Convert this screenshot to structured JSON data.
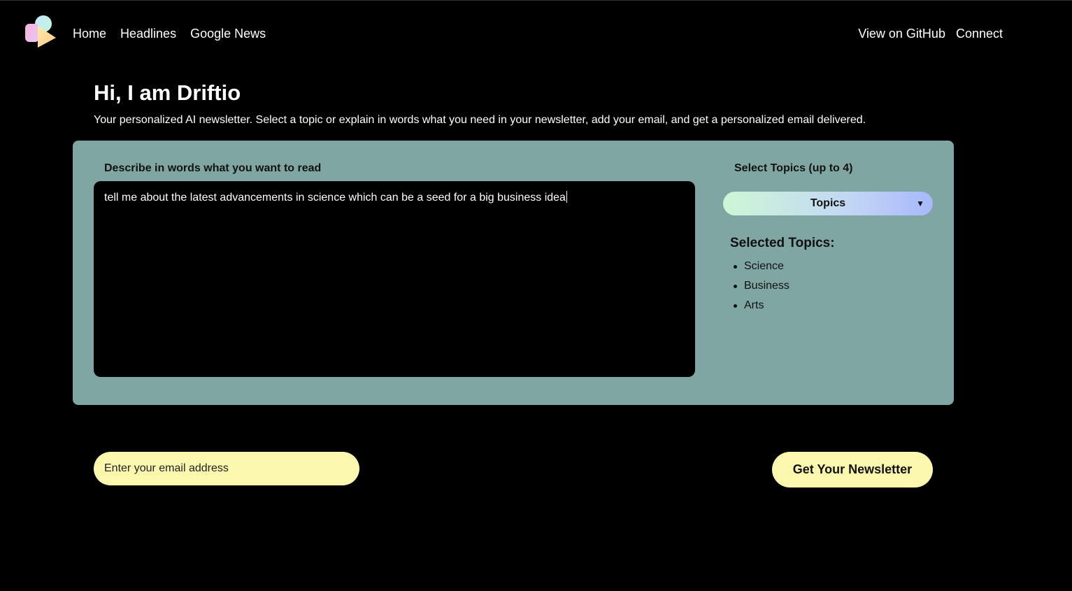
{
  "nav": {
    "logo_icon": "driftio-logo-icon",
    "left_links": [
      "Home",
      "Headlines",
      "Google News"
    ],
    "right_links": [
      "View on GitHub",
      "Connect"
    ]
  },
  "hero": {
    "title": "Hi, I am Driftio",
    "subtitle": "Your personalized AI newsletter. Select a topic or explain in words what you need in your newsletter, add your email, and get a personalized email delivered."
  },
  "panel": {
    "describe_label": "Describe in words what you want to read",
    "describe_value": "tell me about the latest advancements in science which can be a seed for a big business idea",
    "topics_label": "Select Topics (up to 4)",
    "dropdown_label": "Topics",
    "dropdown_arrow": "▼",
    "selected_title": "Selected Topics:",
    "selected_topics": [
      "Science",
      "Business",
      "Arts"
    ]
  },
  "form": {
    "email_placeholder": "Enter your email address",
    "submit_label": "Get Your Newsletter"
  },
  "colors": {
    "background": "#000000",
    "panel": "#80a6a4",
    "input_yellow": "#fbf8ad"
  }
}
